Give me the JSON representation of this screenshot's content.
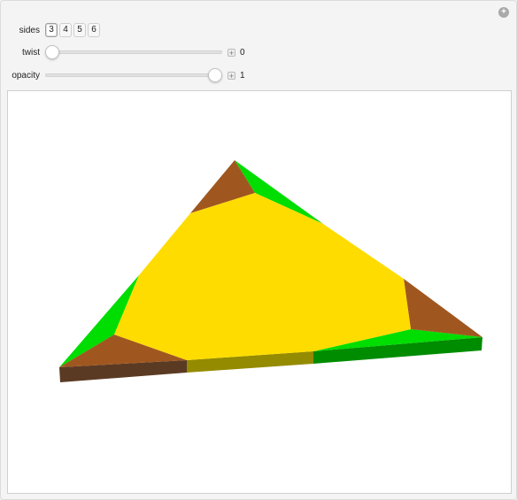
{
  "controls": {
    "sides": {
      "label": "sides",
      "options": [
        "3",
        "4",
        "5",
        "6"
      ],
      "selected": "3"
    },
    "twist": {
      "label": "twist",
      "value": "0",
      "fraction": 0.0
    },
    "opacity": {
      "label": "opacity",
      "value": "1",
      "fraction": 1.0
    }
  },
  "plot": {
    "colors": {
      "yellow_face": "#FFDC00",
      "green_corner": "#00DD00",
      "brown_corner": "#A0571F",
      "edge_dark_brown": "#5B3A24",
      "edge_olive": "#948B00",
      "edge_green": "#008C00"
    }
  },
  "icons": {
    "corner": "plus-circle-icon",
    "slider_expand": "plus-square-icon"
  }
}
